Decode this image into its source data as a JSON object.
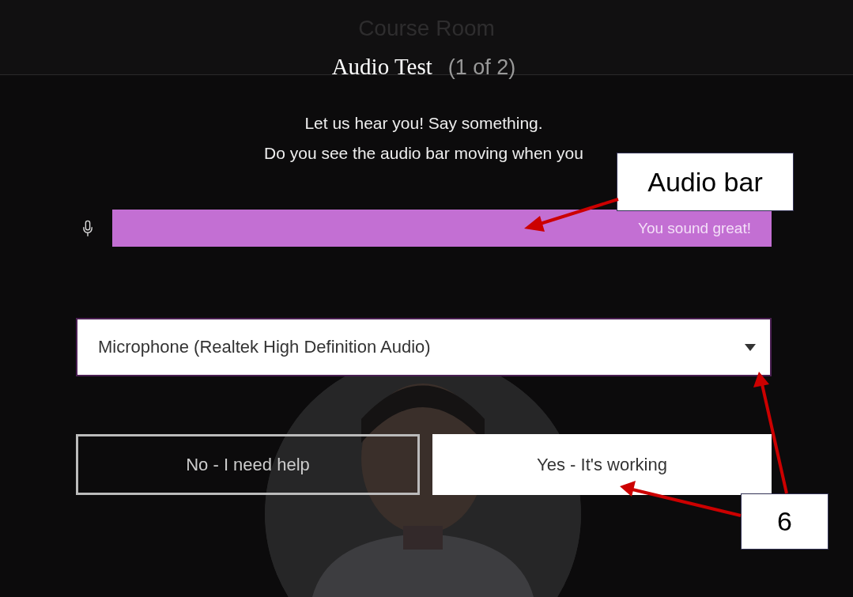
{
  "header": {
    "title": "Course Room"
  },
  "dialog": {
    "title": "Audio Test",
    "step": "(1 of 2)",
    "lines": [
      "Let us hear you! Say something.",
      "Do you see the audio bar moving when you"
    ]
  },
  "audio_meter": {
    "level": 1,
    "reading": "You sound great!"
  },
  "microphone_select": {
    "value": "Microphone (Realtek High Definition Audio)"
  },
  "buttons": [
    {
      "label": "No - I need help",
      "kind": "outline"
    },
    {
      "label": "Yes - It's working",
      "kind": "solid"
    }
  ],
  "callouts": [
    {
      "label": "Audio bar"
    },
    {
      "label": "6"
    }
  ]
}
